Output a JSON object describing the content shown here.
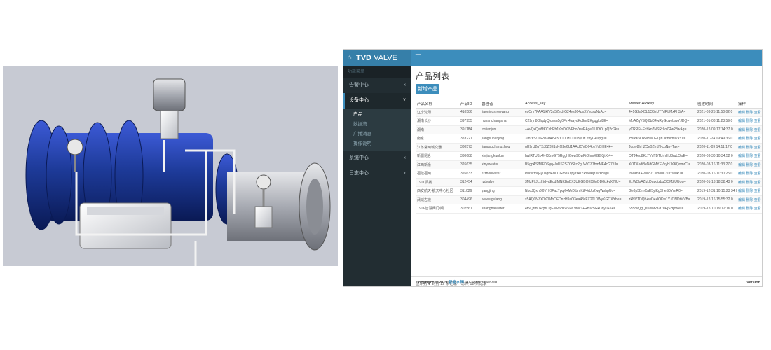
{
  "brand": {
    "name": "TVD",
    "suffix": "VALVE",
    "home_icon": "home-icon"
  },
  "toggle_icon": "menu-icon",
  "sidebar": {
    "header": "功能菜单",
    "items": [
      {
        "label": "告警中心",
        "chevron": "‹"
      },
      {
        "label": "设备中心",
        "chevron": "˅",
        "sub": [
          "产品",
          "数据流",
          "广播消息",
          "操作说明"
        ]
      },
      {
        "label": "系统中心",
        "chevron": "‹"
      },
      {
        "label": "日志中心",
        "chevron": "‹"
      }
    ]
  },
  "main": {
    "title": "产品列表",
    "add_button": "新增产品",
    "columns": [
      "产品名称",
      "产品ID",
      "管理者",
      "Access_key",
      "Master-APIkey",
      "创建时间",
      "操作"
    ],
    "rows": [
      [
        "辽宁沈阳",
        "410586",
        "liaoningshenyang",
        "esOm7FAA1jkfV3a5ZeUrG24ys364pxXYkdsqNvAc=",
        "441G2aXDL1Q5sUT7dRLMxPh3/A=",
        "2021-03-25 11:50:02 0",
        "编辑 删除 查看"
      ],
      [
        "湖南长沙",
        "397955",
        "hunanchangsha",
        "C29rjn8OIqdyQlonsu5g0Fln4aaydKc9mI2Kgqgkd8E=",
        "MoAZqVSQi0bD4wRyGcwebsvYJDQ=",
        "2021-01-08 11:23:59 0",
        "编辑 删除 查看"
      ],
      [
        "湖南",
        "391184",
        "tmtianjun",
        "+AvQxQw8tKCsbRh1KoDKjNFbo/YwEAgeJ1J0tOLpQ2q2k=",
        "yCRRFr-Exbkn7NSRrLo7Rw28wAg=",
        "2020-12-09 17:14:37 0",
        "编辑 删除 查看"
      ],
      [
        "南京",
        "378221",
        "jiangsunanjing",
        "XmIYS/JLF8K9f4zRBIYTJuzLJT0ByDfOf3yGeupgu=",
        "jHuxX5OxwHWJF1grUl6bemu7xYc=",
        "2020-11-24 09:49:36 0",
        "编辑 删除 查看"
      ],
      [
        "江苏常州城交通",
        "380573",
        "jiangsuchangzhou",
        "gU9rU2gTSJ0Z8E1cKO2e6U1AAUOVQ64ozYcBhlE4k=",
        "Jqpw8hHZCeBZe1N-cgNpyTak=",
        "2020-11-09 14:11:17 0",
        "编辑 删除 查看"
      ],
      [
        "新疆昆仑",
        "330688",
        "xinjiangkunlun",
        "hwlRTU3x4/vC8mGT5RggHGew9CwFtOhmXGG0jtXt4=",
        "OTJ4eu8KLTVdTBTUrhHU8ruLOwE=",
        "2020-03-30 10:34:52 0",
        "编辑 删除 查看"
      ],
      [
        "江西新余",
        "326635",
        "xinyuwater",
        "B5gpAS/MEDSgq+/uUS2SZOSkc2gLWtCZ7hmMF4cG7tU=",
        "XOTXedi8eNdGMYFVsyHJKKQomrCI=",
        "2020-03-16 11:33:27 0",
        "编辑 删除 查看"
      ],
      [
        "福建福州",
        "326633",
        "fuzhouwater",
        "P06/kmq+y0JgN4N0CGmeKqhj8zAiYPWlaIy0wYH/g=",
        "InVXnX+VhiiqZCuYouC3DYw0PJ=",
        "2020-03-16 11:30:25 0",
        "编辑 删除 查看"
      ],
      [
        "TVD 调拨",
        "312454",
        "tvdvalve",
        "3MzF7JLzI5d+dEcdIMNKBnBX3UEGBQEX8uODGxkyXfNU=",
        "EzWQpAZqLDqpgjzbgOOMZUUqw=",
        "2020-01-13 18:38:43 0",
        "编辑 删除 查看"
      ],
      [
        "西安航天·航天中心社区",
        "311026",
        "yangjing",
        "NbuJQxh8OYHOFaxTpqK+MrDtbmKtF4rUu2wgWsbpUo=",
        "Ge8p5BmCaE5ylKgSheS0YrnR0=",
        "2019-12-31 10:15:23 34 0",
        "编辑 删除 查看"
      ],
      [
        "武威古浪",
        "304496",
        "wuweigulang",
        "s5AQ0NZX0K0MbOFDnzH9aO3ea43cFX20L0WyKGOXYhe=",
        "zkNVTDQb+wO4xlOKw1YJONDtMVB=",
        "2019-12-16 15:55:32 0",
        "编辑 删除 查看"
      ],
      [
        "TVD-智慧阀门/阀",
        "302561",
        "shanghaiwater",
        "4fNQrmOPgwUgEMP6dLwSwL9Mc1+Rb0c5GkU8yu+u+=",
        "655cvQgQe5isM2Kd7dPjSHjYNeI=",
        "2019-12-10 19:12:16 0",
        "编辑 删除 查看"
      ]
    ],
    "pager_text": "显示第 1 到第 12 条记录，总共 12 条记录"
  },
  "footer": {
    "copyright": "Copyright © 2019",
    "company": "智能水阀.",
    "rights": "All rights reserved.",
    "version": "Version"
  },
  "colors": {
    "header": "#3c8dbc",
    "brand": "#367fa9",
    "sidebar": "#222d32",
    "valve_body": "#1d3a98",
    "flange_gray": "#9ea2aa"
  }
}
